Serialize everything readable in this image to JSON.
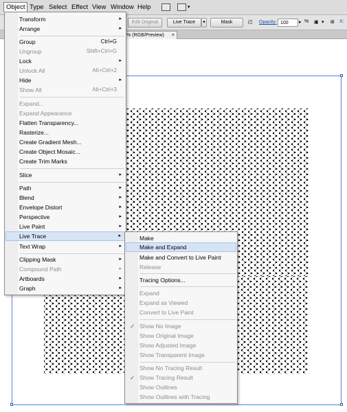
{
  "menubar": {
    "items": [
      "Object",
      "Type",
      "Select",
      "Effect",
      "View",
      "Window",
      "Help"
    ]
  },
  "controlbar": {
    "edit_original": "Edit Original",
    "live_trace": "Live Trace",
    "mask": "Mask",
    "opacity_label": "Opacity:",
    "opacity_value": "100",
    "percent": "%"
  },
  "document_tab": {
    "title": "% (RGB/Preview)",
    "close": "×"
  },
  "object_menu": {
    "items": [
      {
        "label": "Transform",
        "submenu": true
      },
      {
        "label": "Arrange",
        "submenu": true
      },
      {
        "label": "Group",
        "shortcut": "Ctrl+G"
      },
      {
        "label": "Ungroup",
        "shortcut": "Shift+Ctrl+G",
        "disabled": true
      },
      {
        "label": "Lock",
        "submenu": true
      },
      {
        "label": "Unlock All",
        "shortcut": "Alt+Ctrl+2",
        "disabled": true
      },
      {
        "label": "Hide",
        "submenu": true
      },
      {
        "label": "Show All",
        "shortcut": "Alt+Ctrl+3",
        "disabled": true
      },
      {
        "label": "Expand...",
        "disabled": true
      },
      {
        "label": "Expand Appearance",
        "disabled": true
      },
      {
        "label": "Flatten Transparency..."
      },
      {
        "label": "Rasterize..."
      },
      {
        "label": "Create Gradient Mesh..."
      },
      {
        "label": "Create Object Mosaic..."
      },
      {
        "label": "Create Trim Marks"
      },
      {
        "label": "Slice",
        "submenu": true
      },
      {
        "label": "Path",
        "submenu": true
      },
      {
        "label": "Blend",
        "submenu": true
      },
      {
        "label": "Envelope Distort",
        "submenu": true
      },
      {
        "label": "Perspective",
        "submenu": true
      },
      {
        "label": "Live Paint",
        "submenu": true
      },
      {
        "label": "Live Trace",
        "submenu": true,
        "highlighted": true
      },
      {
        "label": "Text Wrap",
        "submenu": true
      },
      {
        "label": "Clipping Mask",
        "submenu": true
      },
      {
        "label": "Compound Path",
        "submenu": true,
        "disabled": true
      },
      {
        "label": "Artboards",
        "submenu": true
      },
      {
        "label": "Graph",
        "submenu": true
      }
    ]
  },
  "live_trace_menu": {
    "items": [
      {
        "label": "Make"
      },
      {
        "label": "Make and Expand",
        "highlighted": true
      },
      {
        "label": "Make and Convert to Live Paint"
      },
      {
        "label": "Release",
        "disabled": true
      },
      {
        "label": "Tracing Options..."
      },
      {
        "label": "Expand",
        "disabled": true
      },
      {
        "label": "Expand as Viewed",
        "disabled": true
      },
      {
        "label": "Convert to Live Paint",
        "disabled": true
      },
      {
        "label": "Show No Image",
        "disabled": true,
        "checked": true
      },
      {
        "label": "Show Original Image",
        "disabled": true
      },
      {
        "label": "Show Adjusted Image",
        "disabled": true
      },
      {
        "label": "Show Transparent Image",
        "disabled": true
      },
      {
        "label": "Show No Tracing Result",
        "disabled": true
      },
      {
        "label": "Show Tracing Result",
        "disabled": true,
        "checked": true
      },
      {
        "label": "Show Outlines",
        "disabled": true
      },
      {
        "label": "Show Outlines with Tracing",
        "disabled": true
      }
    ]
  },
  "glyphs": {
    "arrow": "▸",
    "check": "✓",
    "dropdown": "▾"
  }
}
